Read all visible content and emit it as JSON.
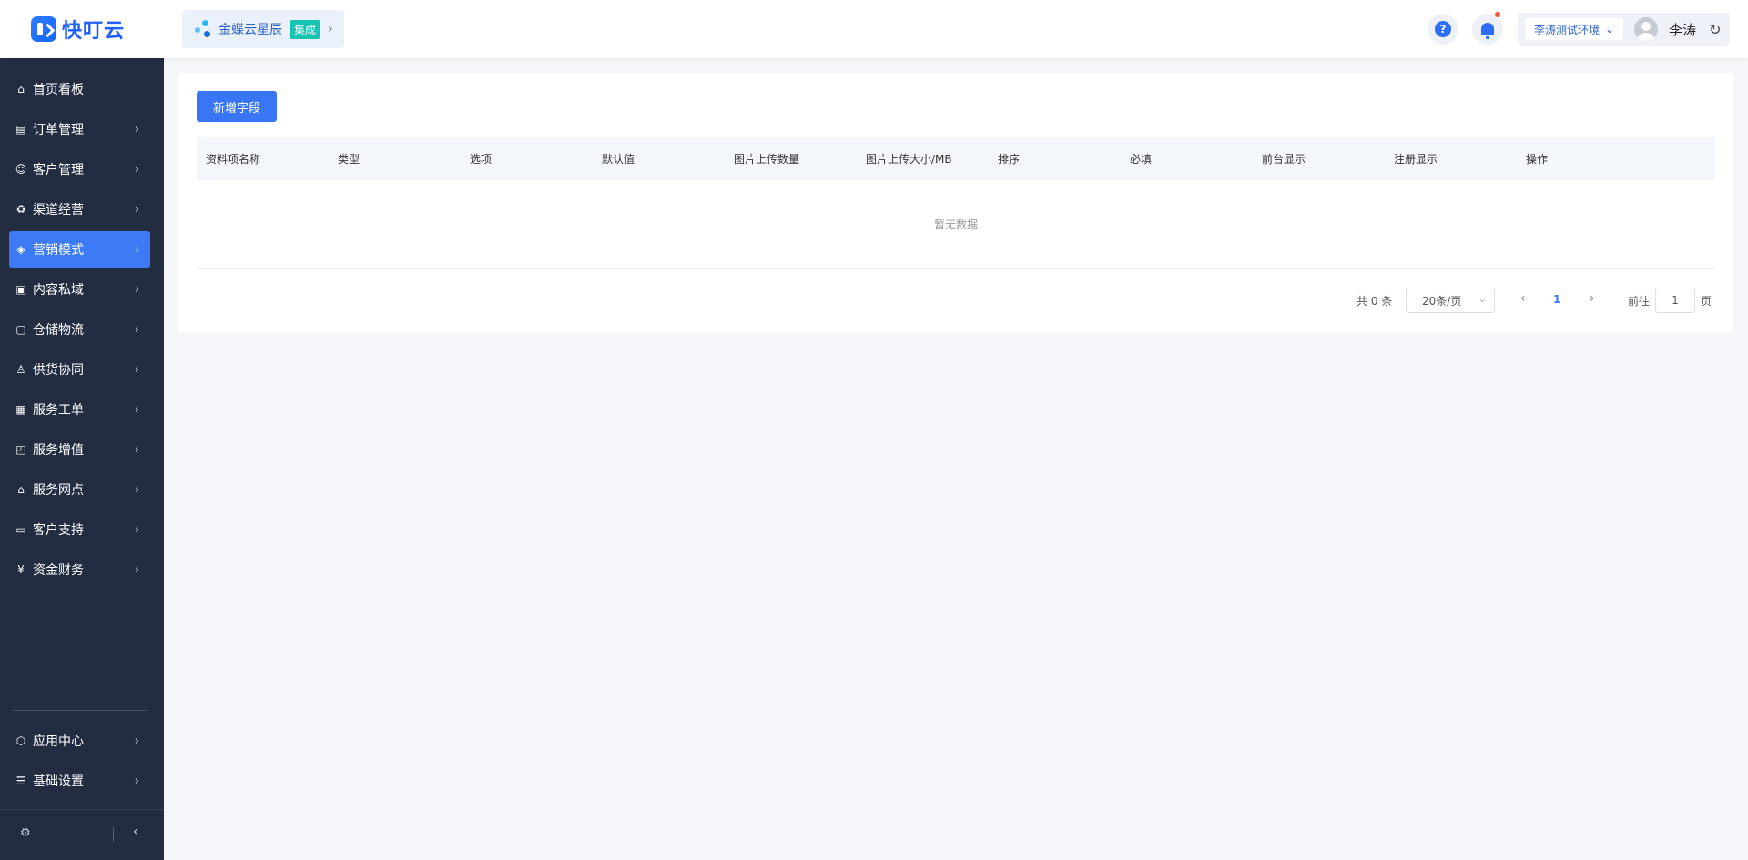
{
  "header": {
    "logo_text": "快叮云",
    "integration": {
      "name": "金蝶云星辰",
      "badge": "集成"
    },
    "help_label": "?",
    "environment": "李涛测试环境",
    "user_name": "李涛"
  },
  "sidebar": {
    "items": [
      {
        "label": "首页看板",
        "icon": "home-icon",
        "glyph": "⌂",
        "chevron": false
      },
      {
        "label": "订单管理",
        "icon": "clipboard-icon",
        "glyph": "▤",
        "chevron": true
      },
      {
        "label": "客户管理",
        "icon": "person-icon",
        "glyph": "☺",
        "chevron": true
      },
      {
        "label": "渠道经营",
        "icon": "recycle-icon",
        "glyph": "♻",
        "chevron": true
      },
      {
        "label": "营销模式",
        "icon": "tag-icon",
        "glyph": "◈",
        "chevron": true,
        "active": true
      },
      {
        "label": "内容私域",
        "icon": "image-icon",
        "glyph": "▣",
        "chevron": true
      },
      {
        "label": "仓储物流",
        "icon": "box-icon",
        "glyph": "▢",
        "chevron": true
      },
      {
        "label": "供货协同",
        "icon": "user-sync-icon",
        "glyph": "♙",
        "chevron": true
      },
      {
        "label": "服务工单",
        "icon": "ticket-icon",
        "glyph": "▦",
        "chevron": true
      },
      {
        "label": "服务增值",
        "icon": "bag-icon",
        "glyph": "◰",
        "chevron": true
      },
      {
        "label": "服务网点",
        "icon": "store-icon",
        "glyph": "⌂",
        "chevron": true
      },
      {
        "label": "客户支持",
        "icon": "support-icon",
        "glyph": "▭",
        "chevron": true
      },
      {
        "label": "资金财务",
        "icon": "yen-icon",
        "glyph": "¥",
        "chevron": true
      }
    ],
    "bottom_items": [
      {
        "label": "应用中心",
        "icon": "cube-icon",
        "glyph": "⬡",
        "chevron": true
      },
      {
        "label": "基础设置",
        "icon": "sliders-icon",
        "glyph": "☰",
        "chevron": true
      }
    ]
  },
  "main": {
    "add_button": "新增字段",
    "columns": [
      "资料项名称",
      "类型",
      "选项",
      "默认值",
      "图片上传数量",
      "图片上传大小/MB",
      "排序",
      "必填",
      "前台显示",
      "注册显示",
      "操作"
    ],
    "empty_text": "暂无数据",
    "pagination": {
      "total": "共 0 条",
      "page_size": "20条/页",
      "current_page": "1",
      "goto_label": "前往",
      "goto_value": "1",
      "page_unit": "页"
    }
  },
  "colors": {
    "primary": "#3976f6",
    "sidebar_bg": "#232d42",
    "badge": "#17c3b2"
  }
}
